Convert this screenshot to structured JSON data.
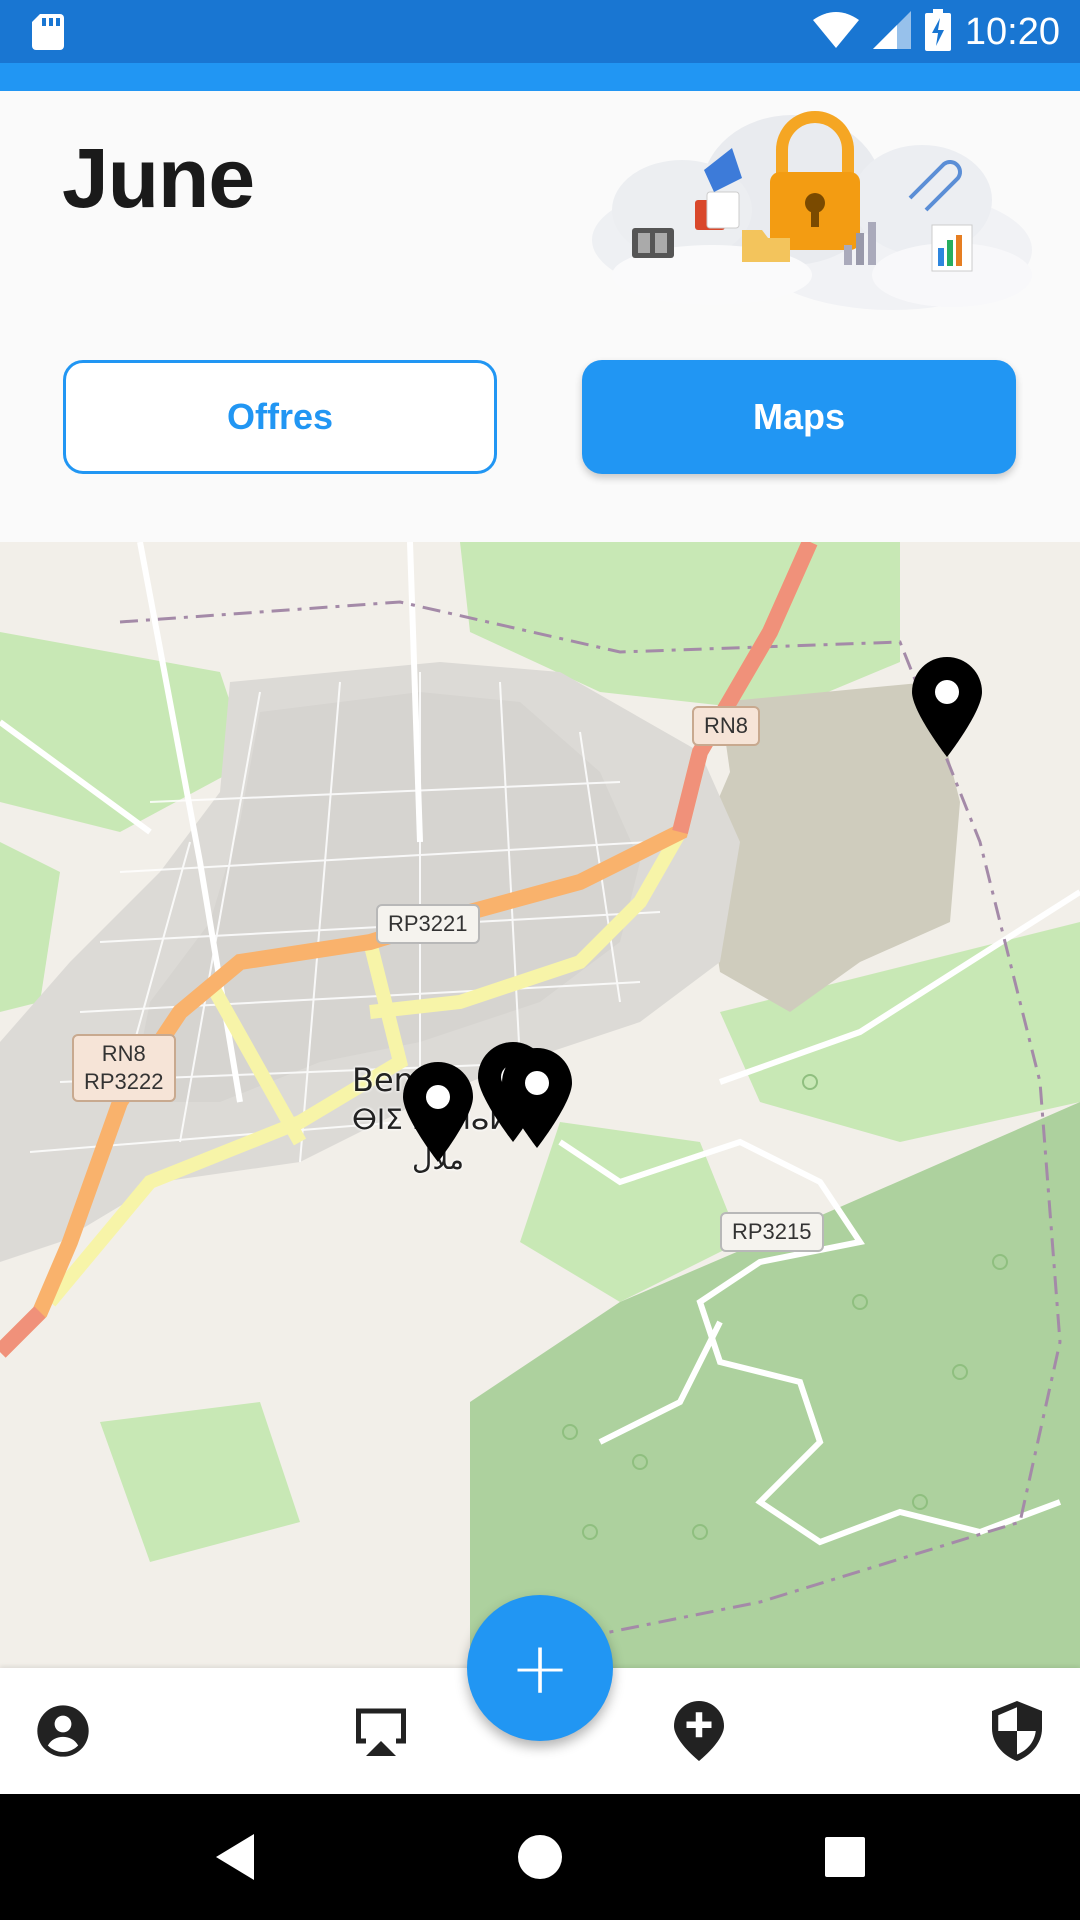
{
  "status_bar": {
    "time": "10:20",
    "icons": [
      "sd-card-icon",
      "wifi-icon",
      "signal-icon",
      "battery-charging-icon"
    ]
  },
  "header": {
    "title": "June",
    "illustration": "cloud-storage-illustration"
  },
  "tabs": {
    "offres_label": "Offres",
    "maps_label": "Maps",
    "active": "Maps"
  },
  "map": {
    "town_name_latin": "Ben",
    "town_name_tifinagh": "ⴱⵏⵉ ⵎⵍⵍⴰⵍ",
    "town_name_arabic": "ملال",
    "road_labels": {
      "rn8_top": "RN8",
      "rp3221": "RP3221",
      "rn8_left_line1": "RN8",
      "rn8_left_line2": "RP3222",
      "rp3215": "RP3215"
    },
    "marker_count": 4
  },
  "fab": {
    "icon": "plus-icon",
    "label": "+"
  },
  "bottom_nav": {
    "items": [
      "account-circle-icon",
      "airplay-icon",
      "add-location-icon",
      "security-shield-icon"
    ]
  },
  "system_nav": {
    "items": [
      "back-icon",
      "home-icon",
      "recents-icon"
    ]
  },
  "colors": {
    "primary": "#2196F3",
    "status_bar": "#1976D2",
    "background": "#FAFAFA"
  }
}
